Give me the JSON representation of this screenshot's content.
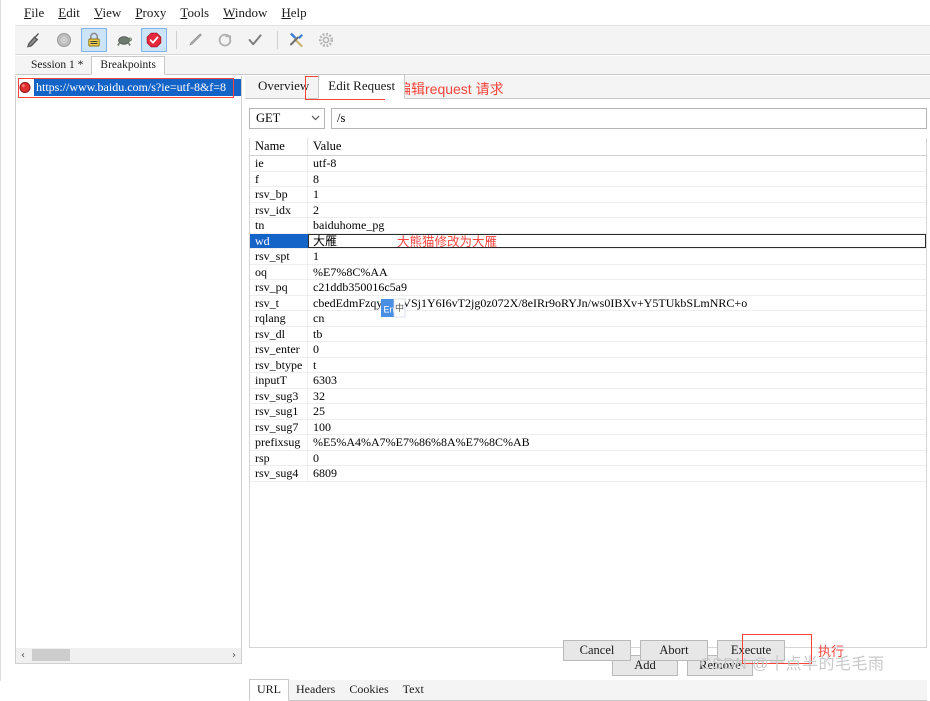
{
  "menubar": {
    "items": [
      {
        "mnemonic": "F",
        "rest": "ile"
      },
      {
        "mnemonic": "E",
        "rest": "dit"
      },
      {
        "mnemonic": "V",
        "rest": "iew"
      },
      {
        "mnemonic": "P",
        "rest": "roxy"
      },
      {
        "mnemonic": "T",
        "rest": "ools"
      },
      {
        "mnemonic": "W",
        "rest": "indow"
      },
      {
        "mnemonic": "H",
        "rest": "elp"
      }
    ]
  },
  "toolbar": {
    "buttons": [
      {
        "icon": "broom-icon",
        "active": false
      },
      {
        "icon": "record-circle-icon",
        "active": false
      },
      {
        "icon": "lock-icon",
        "active": true
      },
      {
        "icon": "turtle-icon",
        "active": false
      },
      {
        "icon": "stop-sign-icon",
        "active": true
      },
      {
        "icon": "pen-icon",
        "active": false
      },
      {
        "icon": "refresh-icon",
        "active": false
      },
      {
        "icon": "checkmark-icon",
        "active": false
      },
      {
        "icon": "tools-icon",
        "active": false
      },
      {
        "icon": "gear-icon",
        "active": false
      }
    ]
  },
  "session_tabs": {
    "items": [
      {
        "label": "Session 1 *",
        "selected": false
      },
      {
        "label": "Breakpoints",
        "selected": true
      }
    ]
  },
  "left_panel": {
    "breakpoint": {
      "icon": "breakpoint-dot-icon",
      "url": "https://www.baidu.com/s?ie=utf-8&f=8"
    },
    "scrollbar": {
      "left_arrow": "‹",
      "right_arrow": "›"
    }
  },
  "right_panel": {
    "tabs": [
      {
        "label": "Overview",
        "selected": false
      },
      {
        "label": "Edit Request",
        "selected": true
      }
    ],
    "annotation_tab": "编辑request 请求",
    "request_line": {
      "method": "GET",
      "method_caret": "⌄",
      "path": "/s"
    },
    "table": {
      "headers": [
        "Name",
        "Value"
      ],
      "rows": [
        {
          "name": "ie",
          "value": "utf-8",
          "selected": false
        },
        {
          "name": "f",
          "value": "8",
          "selected": false
        },
        {
          "name": "rsv_bp",
          "value": "1",
          "selected": false
        },
        {
          "name": "rsv_idx",
          "value": "2",
          "selected": false
        },
        {
          "name": "tn",
          "value": "baiduhome_pg",
          "selected": false
        },
        {
          "name": "wd",
          "value": "大雁",
          "selected": true
        },
        {
          "name": "rsv_spt",
          "value": "1",
          "selected": false
        },
        {
          "name": "oq",
          "value": "%E7%8C%AA",
          "selected": false
        },
        {
          "name": "rsv_pq",
          "value": "c21ddb350016c5a9",
          "selected": false
        },
        {
          "name": "rsv_t",
          "value": "cbedEdmFzqykuCVSj1Y6I6vT2jg0z072X/8eIRr9oRYJn/ws0IBXv+Y5TUkbSLmNRC+o",
          "selected": false
        },
        {
          "name": "rqlang",
          "value": "cn",
          "selected": false
        },
        {
          "name": "rsv_dl",
          "value": "tb",
          "selected": false
        },
        {
          "name": "rsv_enter",
          "value": "0",
          "selected": false
        },
        {
          "name": "rsv_btype",
          "value": "t",
          "selected": false
        },
        {
          "name": "inputT",
          "value": "6303",
          "selected": false
        },
        {
          "name": "rsv_sug3",
          "value": "32",
          "selected": false
        },
        {
          "name": "rsv_sug1",
          "value": "25",
          "selected": false
        },
        {
          "name": "rsv_sug7",
          "value": "100",
          "selected": false
        },
        {
          "name": "prefixsug",
          "value": "%E5%A4%A7%E7%86%8A%E7%8C%AB",
          "selected": false
        },
        {
          "name": "rsp",
          "value": "0",
          "selected": false
        },
        {
          "name": "rsv_sug4",
          "value": "6809",
          "selected": false
        }
      ],
      "row_annotation": "大熊猫修改为大雁"
    },
    "row_buttons": [
      {
        "label": "Add"
      },
      {
        "label": "Remove"
      }
    ],
    "bottom_tabs": [
      {
        "label": "URL",
        "selected": true
      },
      {
        "label": "Headers",
        "selected": false
      },
      {
        "label": "Cookies",
        "selected": false
      },
      {
        "label": "Text",
        "selected": false
      }
    ],
    "action_buttons": [
      {
        "label": "Cancel"
      },
      {
        "label": "Abort"
      },
      {
        "label": "Execute"
      }
    ],
    "annotation_execute": "执行"
  },
  "ime": {
    "label": "En",
    "secondary": "中"
  },
  "watermark": "CSDN @十点半的毛毛雨",
  "colors": {
    "accent_blue": "#1464c8",
    "annotation_red": "#f4443c",
    "toolbar_active": "#cce4f7",
    "panel_bg": "#f4f4f4"
  }
}
